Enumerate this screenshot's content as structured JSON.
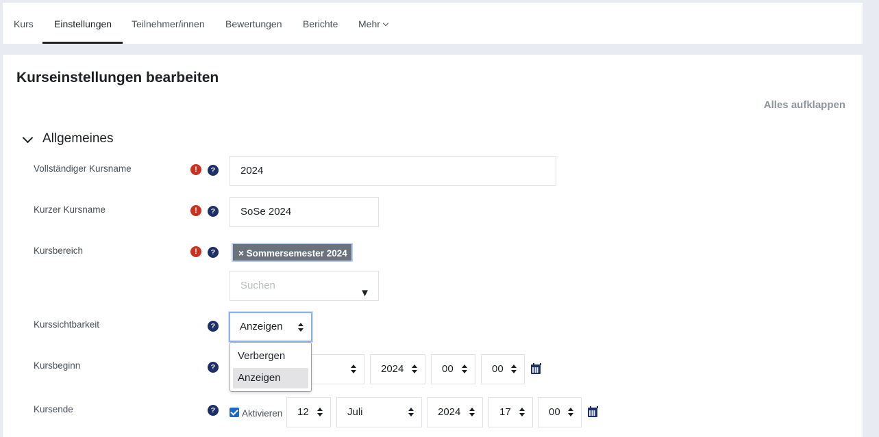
{
  "tabs": [
    {
      "label": "Kurs"
    },
    {
      "label": "Einstellungen"
    },
    {
      "label": "Teilnehmer/innen"
    },
    {
      "label": "Bewertungen"
    },
    {
      "label": "Berichte"
    },
    {
      "label": "Mehr"
    }
  ],
  "page": {
    "title": "Kurseinstellungen bearbeiten",
    "expand_all": "Alles aufklappen",
    "section_title": "Allgemeines"
  },
  "icons": {
    "required": "exclamation-circle-icon",
    "help": "question-circle-icon",
    "calendar": "calendar-icon"
  },
  "colors": {
    "required": "#ca3120",
    "help": "#1d2f6b",
    "chip": "#6a737b",
    "checkbox": "#1d67c9"
  },
  "form": {
    "fullname": {
      "label": "Vollständiger Kursname",
      "value": "2024"
    },
    "shortname": {
      "label": "Kurzer Kursname",
      "value": "SoSe 2024"
    },
    "category": {
      "label": "Kursbereich",
      "chip": "× Sommersemester 2024",
      "search_placeholder": "Suchen"
    },
    "visibility": {
      "label": "Kurssichtbarkeit",
      "value": "Anzeigen",
      "options": [
        "Verbergen",
        "Anzeigen"
      ]
    },
    "startdate": {
      "label": "Kursbeginn",
      "year": "2024",
      "hour": "00",
      "minute": "00"
    },
    "enddate": {
      "label": "Kursende",
      "enable_label": "Aktivieren",
      "day": "12",
      "month": "Juli",
      "year": "2024",
      "hour": "17",
      "minute": "00"
    }
  }
}
